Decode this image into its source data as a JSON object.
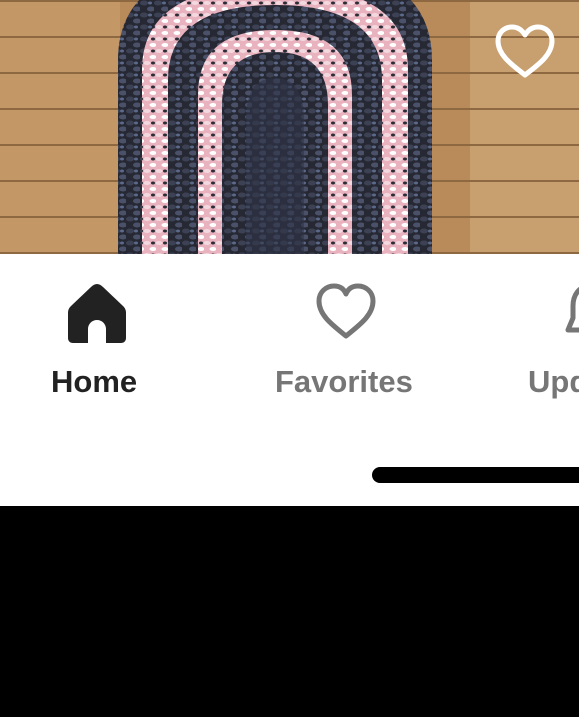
{
  "product": {
    "favorite_icon": "heart-outline-icon"
  },
  "tabbar": {
    "tabs": [
      {
        "id": "home",
        "label": "Home",
        "icon": "home-icon",
        "active": true
      },
      {
        "id": "favorites",
        "label": "Favorites",
        "icon": "heart-outline-icon",
        "active": false
      },
      {
        "id": "updates",
        "label": "Upd",
        "icon": "bell-icon",
        "active": false
      }
    ]
  },
  "colors": {
    "active_tab": "#222222",
    "inactive_tab": "#767676",
    "tabbar_bg": "#ffffff",
    "rug_dark": "#2b2d38",
    "rug_pink": "#e9b8c2",
    "floor_wood": "#b88a58"
  }
}
